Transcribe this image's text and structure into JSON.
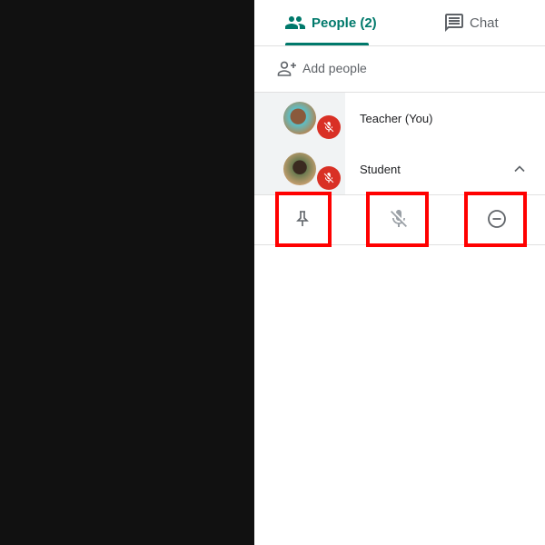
{
  "tabs": [
    {
      "label": "People (2)",
      "icon": "people-icon",
      "active": true
    },
    {
      "label": "Chat",
      "icon": "chat-icon",
      "active": false
    }
  ],
  "add_people": {
    "label": "Add people",
    "icon": "person-add-icon"
  },
  "participants": [
    {
      "name": "Teacher (You)",
      "muted": true
    },
    {
      "name": "Student",
      "muted": true,
      "expanded": true
    }
  ],
  "actions": [
    {
      "icon": "pin-icon"
    },
    {
      "icon": "mic-off-icon"
    },
    {
      "icon": "remove-icon"
    }
  ],
  "colors": {
    "accent": "#00796b",
    "muted_badge": "#d93025",
    "highlight_box": "#ff0000"
  }
}
